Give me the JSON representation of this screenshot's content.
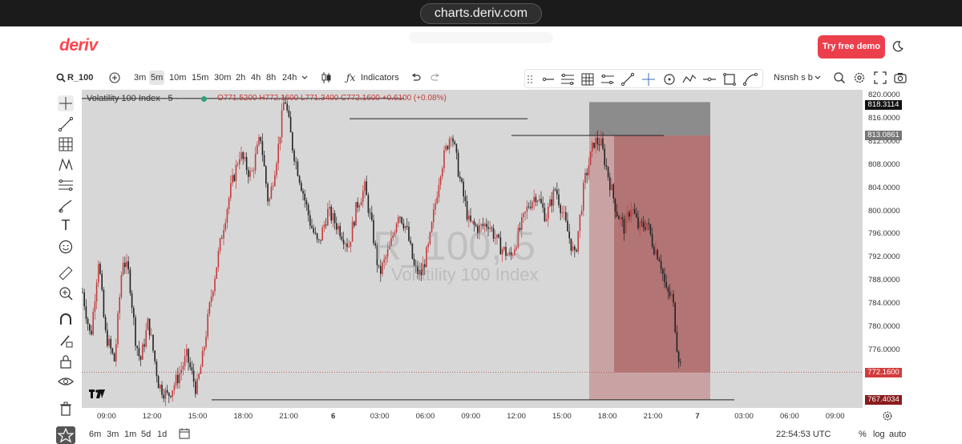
{
  "browser": {
    "url": "charts.deriv.com"
  },
  "header": {
    "logo": "deriv",
    "demo_button": "Try free demo"
  },
  "toolbar": {
    "symbol": "R_100",
    "timeframes": [
      "3m",
      "5m",
      "10m",
      "15m",
      "30m",
      "2h",
      "4h",
      "8h",
      "24h"
    ],
    "active_timeframe": "5m",
    "indicators": "Indicators",
    "template_name": "Nsnsh s b"
  },
  "legend": {
    "name": "Volatility 100 Index · 5 ·",
    "ohlc": "O771.5200  H772.1600  L771.3400  C772.1600  +0.6100 (+0.08%)"
  },
  "watermark": {
    "symbol": "R_100, 5",
    "name": "Volatility 100 Index"
  },
  "chart_data": {
    "type": "candlestick",
    "y_ticks": [
      "820.0000",
      "816.0000",
      "812.0000",
      "808.0000",
      "804.0000",
      "800.0000",
      "796.0000",
      "792.0000",
      "788.0000",
      "784.0000",
      "780.0000",
      "776.0000"
    ],
    "y_range": [
      766.0,
      821.0
    ],
    "x_ticks": [
      "09:00",
      "12:00",
      "15:00",
      "18:00",
      "21:00",
      "6",
      "03:00",
      "06:00",
      "09:00",
      "12:00",
      "15:00",
      "18:00",
      "21:00",
      "7",
      "03:00",
      "06:00",
      "09:00"
    ],
    "price_tags": [
      {
        "value": "818.3114",
        "color": "#111111"
      },
      {
        "value": "813.0861",
        "color": "#777777"
      },
      {
        "value": "772.1600",
        "color": "#d23c3c"
      },
      {
        "value": "767.4034",
        "color": "#8a1c1c"
      }
    ],
    "horizontal_lines": [
      819.5,
      816.0,
      813.1,
      767.4
    ],
    "close_price": 772.16,
    "position_tool": {
      "type": "short",
      "entry": 813.0861,
      "stop": 818.3114,
      "target": 767.4034
    },
    "key_points": [
      [
        0,
        786
      ],
      [
        10,
        778
      ],
      [
        20,
        792
      ],
      [
        28,
        779
      ],
      [
        40,
        774
      ],
      [
        50,
        792
      ],
      [
        58,
        789
      ],
      [
        66,
        778
      ],
      [
        72,
        774
      ],
      [
        82,
        781
      ],
      [
        95,
        770
      ],
      [
        106,
        768
      ],
      [
        118,
        771
      ],
      [
        130,
        775
      ],
      [
        142,
        769
      ],
      [
        150,
        775
      ],
      [
        160,
        785
      ],
      [
        175,
        797
      ],
      [
        185,
        804
      ],
      [
        196,
        810
      ],
      [
        210,
        806
      ],
      [
        222,
        813
      ],
      [
        232,
        801
      ],
      [
        244,
        811
      ],
      [
        252,
        820
      ],
      [
        262,
        811
      ],
      [
        272,
        805
      ],
      [
        284,
        798
      ],
      [
        294,
        794
      ],
      [
        306,
        800
      ],
      [
        320,
        797
      ],
      [
        332,
        794
      ],
      [
        342,
        801
      ],
      [
        352,
        804
      ],
      [
        360,
        798
      ],
      [
        370,
        789
      ],
      [
        384,
        794
      ],
      [
        394,
        800
      ],
      [
        404,
        797
      ],
      [
        414,
        790
      ],
      [
        422,
        789
      ],
      [
        432,
        794
      ],
      [
        446,
        807
      ],
      [
        460,
        814
      ],
      [
        470,
        806
      ],
      [
        482,
        798
      ],
      [
        494,
        797
      ],
      [
        506,
        798
      ],
      [
        520,
        794
      ],
      [
        534,
        792
      ],
      [
        546,
        797
      ],
      [
        556,
        801
      ],
      [
        566,
        803
      ],
      [
        578,
        799
      ],
      [
        590,
        804
      ],
      [
        604,
        797
      ],
      [
        614,
        792
      ],
      [
        626,
        805
      ],
      [
        638,
        812
      ],
      [
        646,
        812
      ],
      [
        656,
        806
      ],
      [
        666,
        800
      ],
      [
        676,
        797
      ],
      [
        684,
        801
      ],
      [
        694,
        797
      ],
      [
        704,
        798
      ],
      [
        712,
        794
      ],
      [
        720,
        792
      ],
      [
        728,
        786
      ],
      [
        736,
        785
      ],
      [
        742,
        776
      ],
      [
        748,
        772
      ]
    ]
  },
  "x_axis_time": "22:54:53 UTC",
  "bottom_bar": {
    "periods": [
      "6m",
      "3m",
      "1m",
      "5d",
      "1d"
    ],
    "percent": "%",
    "log": "log",
    "auto": "auto"
  }
}
